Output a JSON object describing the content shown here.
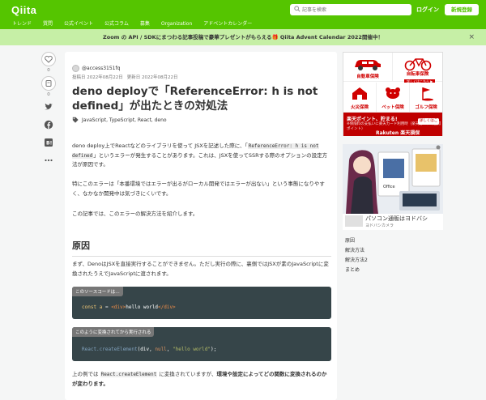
{
  "header": {
    "logo": "Qiita",
    "search_placeholder": "記事を検索",
    "login": "ログイン",
    "signup": "新規登録",
    "nav": [
      "トレンド",
      "質問",
      "公式イベント",
      "公式コラム",
      "募集",
      "Organization",
      "アドベントカレンダー"
    ]
  },
  "banner": {
    "text": "Zoom の API / SDKにまつわる記事投稿で豪華プレゼントがもらえる🎁 Qiita Advent Calendar 2022開催中！",
    "close": "×"
  },
  "actions": {
    "like_count": "0",
    "stock_count": "0"
  },
  "article": {
    "author": "@access3151fq",
    "posted": "投稿日 2022年08月22日",
    "updated": "更新日 2022年08月22日",
    "title": "deno deployで「ReferenceError: h is not defined」が出たときの対処法",
    "tags": "JavaScript, TypeScript, React, deno",
    "p1_a": "deno deploy上でReactなどのライブラリを使って JSXを記述した際に、「",
    "p1_code": "ReferenceError: h is not defined",
    "p1_b": "」というエラーが発生することがあります。これは、JSXを使ってSSRする際のオプションの設定方法が原因です。",
    "p2": "特にこのエラーは「本番環境ではエラーが出るがローカル開発ではエラーが出ない」という事態になりやすく、なかなか開発中は気づきにくいです。",
    "p3": "この記事では、このエラーの解決方法を紹介します。",
    "h2": "原因",
    "p4": "まず、DenoはJSXを直接実行することができません。ただし実行の際に、裏側ではJSXが素のJavaScriptに変換されたうえでJavaScriptに渡されます。",
    "code1_label": "このソースコードは…",
    "code1_keyword": "const",
    "code1_var": "a",
    "code1_eq": "=",
    "code1_open": "<div>",
    "code1_text": "hello world",
    "code1_close": "</div>",
    "code2_label": "このように変換されてから実行される",
    "code2_fn": "React.createElement",
    "code2_arg1": "div",
    "code2_arg2": "null",
    "code2_str": "\"hello world\"",
    "p5_a": "上の例では",
    "p5_code": "React.createElement",
    "p5_b": "に変換されていますが、",
    "p5_bold": "環境や設定によってどの関数に変換されるのかが変わります。"
  },
  "ads": {
    "ins1": "自動車保険",
    "ins2": "自転車保険",
    "ins2_sub": "詳しくはこちら ▶",
    "ins3": "火災保険",
    "ins4": "ペット保険",
    "ins5": "ゴルフ保険",
    "rakuten_t1": "楽天ポイント、貯まる!",
    "rakuten_t2": "※保険料の支払いに楽天カード利用時（楽天カードの獲得ポイント）",
    "rakuten_brand": "Rakuten 楽天損保",
    "rakuten_btn": "詳しくはこちら",
    "pc_caption": "パソコン通販はヨドバシ",
    "pc_sub": "ヨドバシカメラ"
  },
  "toc": [
    "原因",
    "解決方法",
    "解決方法2",
    "まとめ"
  ]
}
